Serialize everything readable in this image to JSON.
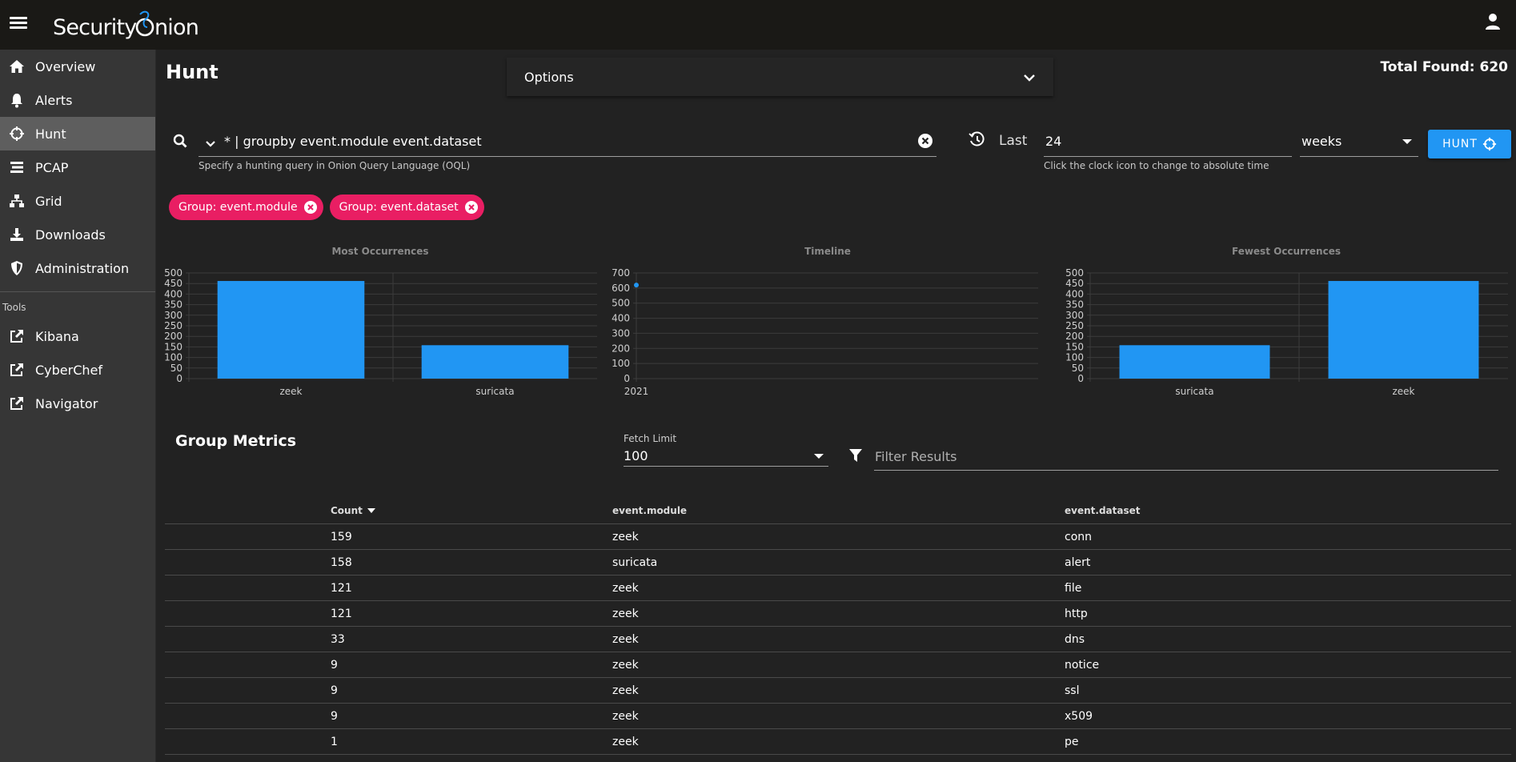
{
  "app": {
    "logo": "Security Onion"
  },
  "sidebar": {
    "items": [
      {
        "label": "Overview",
        "icon": "home-icon"
      },
      {
        "label": "Alerts",
        "icon": "bell-icon"
      },
      {
        "label": "Hunt",
        "icon": "crosshairs-icon",
        "active": true
      },
      {
        "label": "PCAP",
        "icon": "stream-icon"
      },
      {
        "label": "Grid",
        "icon": "sitemap-icon"
      },
      {
        "label": "Downloads",
        "icon": "download-icon"
      },
      {
        "label": "Administration",
        "icon": "shield-icon"
      }
    ],
    "tools_label": "Tools",
    "tools": [
      {
        "label": "Kibana",
        "icon": "external-link-icon"
      },
      {
        "label": "CyberChef",
        "icon": "external-link-icon"
      },
      {
        "label": "Navigator",
        "icon": "external-link-icon"
      }
    ]
  },
  "page": {
    "title": "Hunt",
    "options_label": "Options",
    "total_found": "Total Found: 620"
  },
  "query": {
    "value": "* | groupby event.module event.dataset",
    "hint": "Specify a hunting query in Onion Query Language (OQL)",
    "last_label": "Last",
    "range_value": "24",
    "range_hint": "Click the clock icon to change to absolute time",
    "unit": "weeks",
    "hunt_label": "HUNT"
  },
  "chips": [
    {
      "label": "Group: event.module"
    },
    {
      "label": "Group: event.dataset"
    }
  ],
  "colors": {
    "accent": "#2196f3",
    "chip": "#e91e63",
    "background": "#222222",
    "sidebar": "#363636",
    "topbar": "#1a1916"
  },
  "chart_data": [
    {
      "type": "bar",
      "title": "Most Occurrences",
      "categories": [
        "zeek",
        "suricata"
      ],
      "values": [
        462,
        158
      ],
      "ylim": [
        0,
        500
      ],
      "yticks": [
        0,
        50,
        100,
        150,
        200,
        250,
        300,
        350,
        400,
        450,
        500
      ]
    },
    {
      "type": "line",
      "title": "Timeline",
      "x": [
        "2021"
      ],
      "values": [
        620
      ],
      "ylim": [
        0,
        700
      ],
      "yticks": [
        0,
        100,
        200,
        300,
        400,
        500,
        600,
        700
      ]
    },
    {
      "type": "bar",
      "title": "Fewest Occurrences",
      "categories": [
        "suricata",
        "zeek"
      ],
      "values": [
        158,
        462
      ],
      "ylim": [
        0,
        500
      ],
      "yticks": [
        0,
        50,
        100,
        150,
        200,
        250,
        300,
        350,
        400,
        450,
        500
      ]
    }
  ],
  "metrics": {
    "title": "Group Metrics",
    "fetch_limit_label": "Fetch Limit",
    "fetch_limit_value": "100",
    "filter_placeholder": "Filter Results",
    "columns": [
      "Count",
      "event.module",
      "event.dataset"
    ],
    "rows": [
      {
        "count": "159",
        "module": "zeek",
        "dataset": "conn"
      },
      {
        "count": "158",
        "module": "suricata",
        "dataset": "alert"
      },
      {
        "count": "121",
        "module": "zeek",
        "dataset": "file"
      },
      {
        "count": "121",
        "module": "zeek",
        "dataset": "http"
      },
      {
        "count": "33",
        "module": "zeek",
        "dataset": "dns"
      },
      {
        "count": "9",
        "module": "zeek",
        "dataset": "notice"
      },
      {
        "count": "9",
        "module": "zeek",
        "dataset": "ssl"
      },
      {
        "count": "9",
        "module": "zeek",
        "dataset": "x509"
      },
      {
        "count": "1",
        "module": "zeek",
        "dataset": "pe"
      }
    ]
  }
}
